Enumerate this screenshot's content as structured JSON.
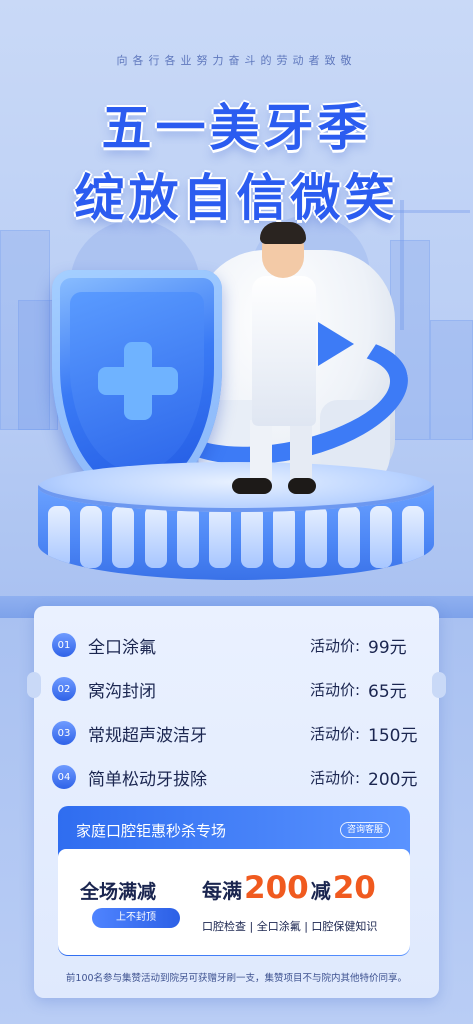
{
  "header": {
    "slogan": "向各行各业努力奋斗的劳动者致敬",
    "title_line1": "五一美牙季",
    "title_line2": "绽放自信微笑"
  },
  "services": [
    {
      "index": "01",
      "name": "全口涂氟",
      "price_label": "活动价:",
      "price": "99元"
    },
    {
      "index": "02",
      "name": "窝沟封闭",
      "price_label": "活动价:",
      "price": "65元"
    },
    {
      "index": "03",
      "name": "常规超声波洁牙",
      "price_label": "活动价:",
      "price": "150元"
    },
    {
      "index": "04",
      "name": "简单松动牙拔除",
      "price_label": "活动价:",
      "price": "200元"
    }
  ],
  "promo": {
    "title": "家庭口腔钜惠秒杀专场",
    "service_button": "咨询客服",
    "main": "全场满减",
    "tag_button": "上不封顶",
    "offer_prefix": "每满",
    "offer_threshold": "200",
    "offer_mid": "减",
    "offer_discount": "20",
    "items": "口腔检查 | 全口涂氟 | 口腔保健知识"
  },
  "footnote": "前100名参与集赞活动到院另可获赠牙刷一支，集赞项目不与院内其他特价同享。",
  "colors": {
    "title_blue": "#2b5cf0",
    "accent_orange": "#f05a1f",
    "card_bg": "#eaf1ff"
  }
}
